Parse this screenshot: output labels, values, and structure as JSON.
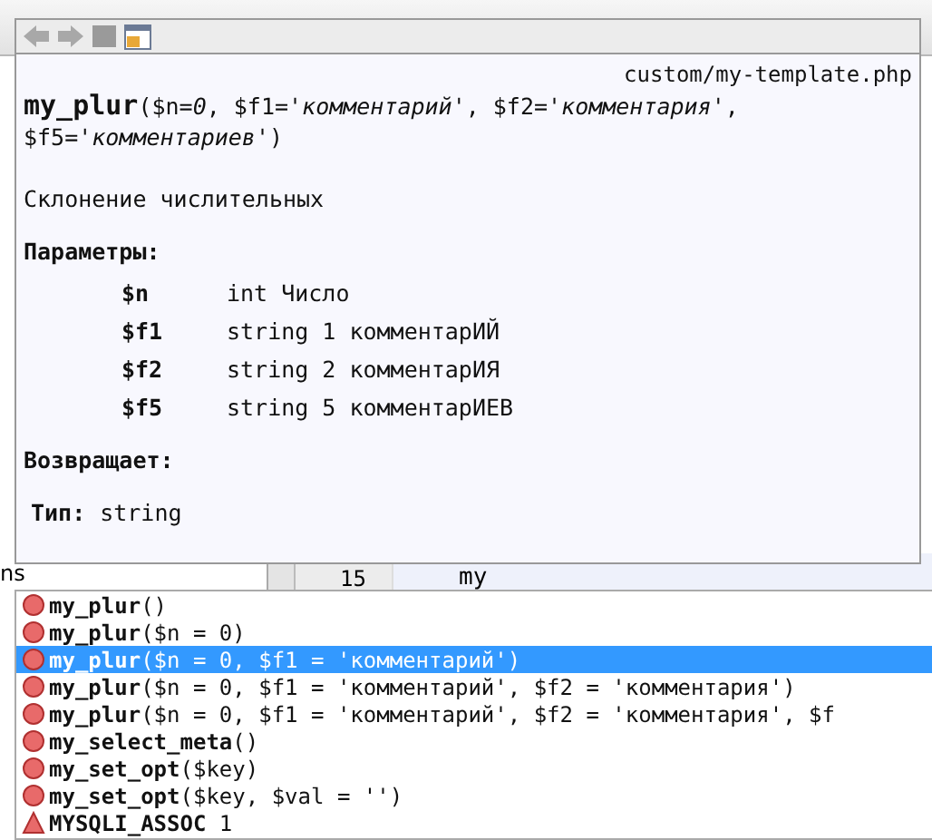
{
  "editor": {
    "sidebar_text": "ns",
    "line_number": "15",
    "code": "my"
  },
  "doc_popup": {
    "file": "custom/my-template.php",
    "signature": "**my_plur**($n=*0*, $f1=*'комментарий'*, $f2=*'комментария'*, $f5=*'комментариев'*)",
    "description": "Склонение числительных",
    "params_heading": "Параметры:",
    "params": [
      {
        "name": "$n",
        "desc": "int Число"
      },
      {
        "name": "$f1",
        "desc": "string 1 комментарИЙ"
      },
      {
        "name": "$f2",
        "desc": "string 2 комментарИЯ"
      },
      {
        "name": "$f5",
        "desc": "string 5 комментарИЕВ"
      }
    ],
    "returns_heading": "Возвращает:",
    "return_label": "Тип:",
    "return_type": "string"
  },
  "completion": {
    "items": [
      {
        "kind": "method",
        "text": "**my_plur**()",
        "selected": false
      },
      {
        "kind": "method",
        "text": "**my_plur**($n = 0)",
        "selected": false
      },
      {
        "kind": "method",
        "text": "**my_plur**($n = 0, $f1 = 'комментарий')",
        "selected": true
      },
      {
        "kind": "method",
        "text": "**my_plur**($n = 0, $f1 = 'комментарий', $f2 = 'комментария')",
        "selected": false
      },
      {
        "kind": "method",
        "text": "**my_plur**($n = 0, $f1 = 'комментарий', $f2 = 'комментария', $f",
        "selected": false
      },
      {
        "kind": "method",
        "text": "**my_select_meta**()",
        "selected": false
      },
      {
        "kind": "method",
        "text": "**my_set_opt**($key)",
        "selected": false
      },
      {
        "kind": "method",
        "text": "**my_set_opt**($key, $val = '')",
        "selected": false
      },
      {
        "kind": "constant",
        "text": "**MYSQLI_ASSOC** 1",
        "selected": false
      }
    ]
  }
}
